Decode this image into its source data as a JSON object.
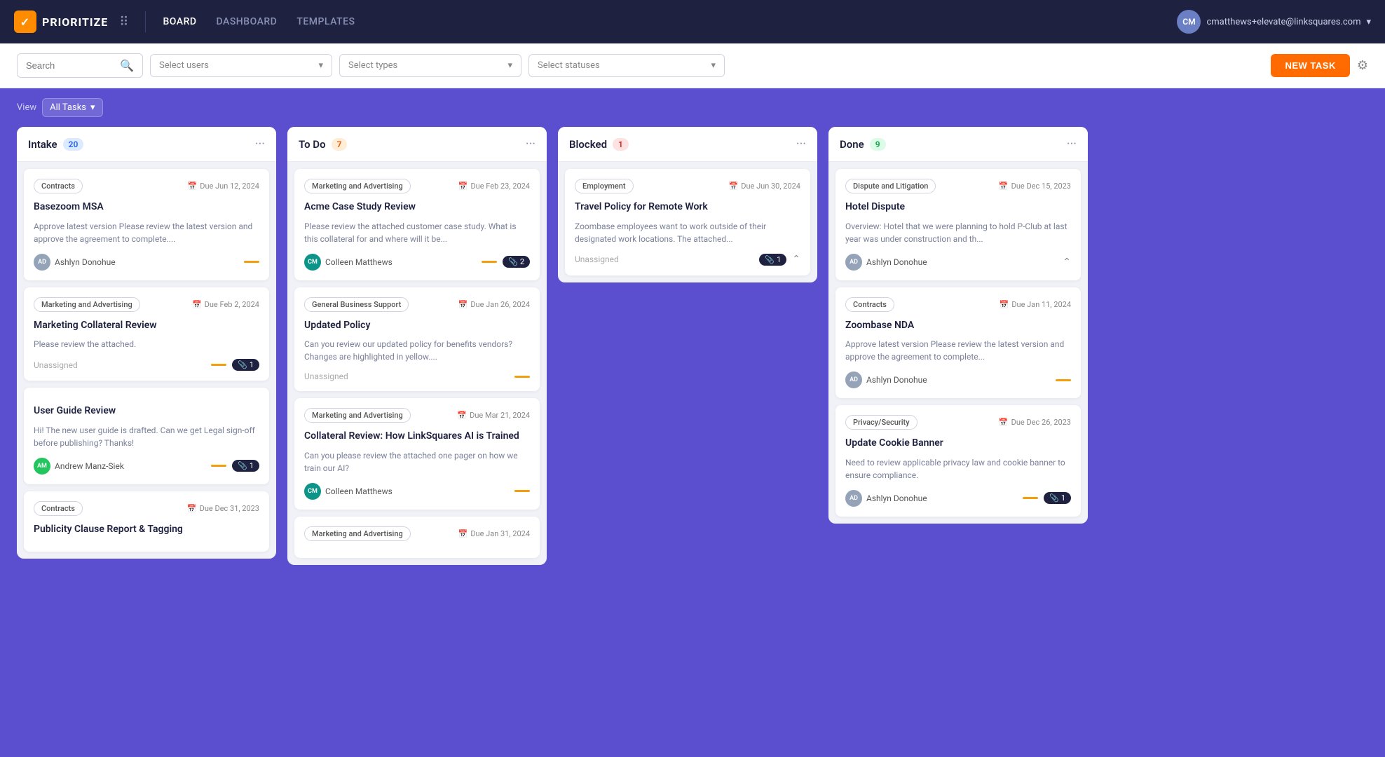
{
  "nav": {
    "logo_text": "PRIORITIZE",
    "links": [
      {
        "label": "BOARD",
        "active": true
      },
      {
        "label": "DASHBOARD",
        "active": false
      },
      {
        "label": "TEMPLATES",
        "active": false
      }
    ],
    "user_email": "cmatthews+elevate@linksquares.com",
    "user_initials": "CM"
  },
  "filters": {
    "search_placeholder": "Search",
    "users_placeholder": "Select users",
    "types_placeholder": "Select types",
    "statuses_placeholder": "Select statuses",
    "new_task_label": "NEW TASK"
  },
  "view": {
    "label": "View",
    "value": "All Tasks"
  },
  "columns": [
    {
      "id": "intake",
      "title": "Intake",
      "count": 20,
      "badge_class": "blue",
      "cards": [
        {
          "type": "Contracts",
          "due": "Due Jun 12, 2024",
          "title": "Basezoom MSA",
          "desc": "Approve latest version Please review the latest version and approve the agreement to complete....",
          "user": "Ashlyn Donohue",
          "user_initials": "AD",
          "avatar_color": "gray",
          "priority": true,
          "attachment": null
        },
        {
          "type": "Marketing and Advertising",
          "due": "Due Feb 2, 2024",
          "title": "Marketing Collateral Review",
          "desc": "Please review the attached.",
          "user": "Unassigned",
          "user_initials": null,
          "avatar_color": null,
          "priority": true,
          "attachment": "1"
        },
        {
          "type": null,
          "due": null,
          "title": "User Guide Review",
          "desc": "Hi! The new user guide is drafted. Can we get Legal sign-off before publishing? Thanks!",
          "user": "Andrew Manz-Siek",
          "user_initials": "AM",
          "avatar_color": "green",
          "priority": true,
          "attachment": "1"
        },
        {
          "type": "Contracts",
          "due": "Due Dec 31, 2023",
          "title": "Publicity Clause Report & Tagging",
          "desc": "",
          "user": null,
          "user_initials": null,
          "avatar_color": null,
          "priority": false,
          "attachment": null
        }
      ]
    },
    {
      "id": "todo",
      "title": "To Do",
      "count": 7,
      "badge_class": "orange",
      "cards": [
        {
          "type": "Marketing and Advertising",
          "due": "Due Feb 23, 2024",
          "title": "Acme Case Study Review",
          "desc": "Please review the attached customer case study. What is this collateral for and where will it be...",
          "user": "Colleen Matthews",
          "user_initials": "CM",
          "avatar_color": "teal",
          "priority": true,
          "attachment": "2"
        },
        {
          "type": "General Business Support",
          "due": "Due Jan 26, 2024",
          "title": "Updated Policy",
          "desc": "Can you review our updated policy for benefits vendors? Changes are highlighted in yellow....",
          "user": "Unassigned",
          "user_initials": null,
          "avatar_color": null,
          "priority": true,
          "attachment": null
        },
        {
          "type": "Marketing and Advertising",
          "due": "Due Mar 21, 2024",
          "title": "Collateral Review: How LinkSquares AI is Trained",
          "desc": "Can you please review the attached one pager on how we train our AI?",
          "user": "Colleen Matthews",
          "user_initials": "CM",
          "avatar_color": "teal",
          "priority": true,
          "attachment": null
        },
        {
          "type": "Marketing and Advertising",
          "due": "Due Jan 31, 2024",
          "title": "",
          "desc": "",
          "user": null,
          "user_initials": null,
          "avatar_color": null,
          "priority": false,
          "attachment": null
        }
      ]
    },
    {
      "id": "blocked",
      "title": "Blocked",
      "count": 1,
      "badge_class": "red",
      "cards": [
        {
          "type": "Employment",
          "due": "Due Jun 30, 2024",
          "title": "Travel Policy for Remote Work",
          "desc": "Zoombase employees want to work outside of their designated work locations. The attached...",
          "user": "Unassigned",
          "user_initials": null,
          "avatar_color": null,
          "priority": false,
          "attachment": "1",
          "expand": true
        }
      ]
    },
    {
      "id": "done",
      "title": "Done",
      "count": 9,
      "badge_class": "green",
      "cards": [
        {
          "type": "Dispute and Litigation",
          "due": "Due Dec 15, 2023",
          "title": "Hotel Dispute",
          "desc": "Overview: Hotel that we were planning to hold P-Club at last year was under construction and th...",
          "user": "Ashlyn Donohue",
          "user_initials": "AD",
          "avatar_color": "gray",
          "priority": false,
          "attachment": null,
          "expand": true
        },
        {
          "type": "Contracts",
          "due": "Due Jan 11, 2024",
          "title": "Zoombase NDA",
          "desc": "Approve latest version Please review the latest version and approve the agreement to complete...",
          "user": "Ashlyn Donohue",
          "user_initials": "AD",
          "avatar_color": "gray",
          "priority": true,
          "attachment": null
        },
        {
          "type": "Privacy/Security",
          "due": "Due Dec 26, 2023",
          "title": "Update Cookie Banner",
          "desc": "Need to review applicable privacy law and cookie banner to ensure compliance.",
          "user": "Ashlyn Donohue",
          "user_initials": "AD",
          "avatar_color": "gray",
          "priority": true,
          "attachment": "1"
        }
      ]
    }
  ]
}
